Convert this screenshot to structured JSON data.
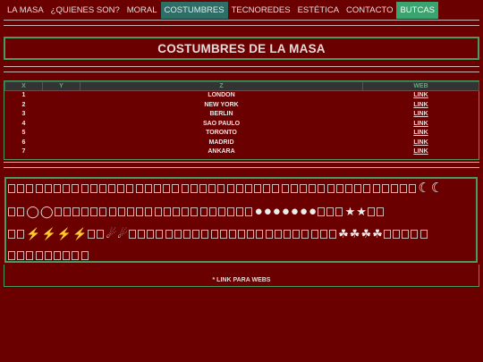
{
  "nav": {
    "items": [
      {
        "label": "LA MASA"
      },
      {
        "label": "¿QUIENES SON?"
      },
      {
        "label": "MORAL"
      },
      {
        "label": "COSTUMBRES"
      },
      {
        "label": "TECNOREDES"
      },
      {
        "label": "ESTÉTICA"
      },
      {
        "label": "CONTACTO"
      },
      {
        "label": "BUTCAS"
      }
    ],
    "active_item": "COSTUMBRES",
    "highlight_item": "BUTCAS"
  },
  "page_title": "COSTUMBRES DE LA MASA",
  "table": {
    "headers": [
      "X",
      "Y",
      "Z",
      "WEB"
    ],
    "rows": [
      {
        "x": "1",
        "y": "",
        "z": "LONDON",
        "web": "LINK"
      },
      {
        "x": "2",
        "y": "",
        "z": "NEW YORK",
        "web": "LINK"
      },
      {
        "x": "3",
        "y": "",
        "z": "BERLIN",
        "web": "LINK"
      },
      {
        "x": "4",
        "y": "",
        "z": "SAO PAULO",
        "web": "LINK"
      },
      {
        "x": "5",
        "y": "",
        "z": "TORONTO",
        "web": "LINK"
      },
      {
        "x": "6",
        "y": "",
        "z": "MADRID",
        "web": "LINK"
      },
      {
        "x": "7",
        "y": "",
        "z": "ANKARA",
        "web": "LINK"
      }
    ]
  },
  "footer_note": "* LINK PARA WEBS",
  "colors": {
    "background": "#6b0000",
    "accent_green": "#4a9a63",
    "active_tab": "#2f6e67",
    "highlight_tab": "#3aa36f"
  }
}
